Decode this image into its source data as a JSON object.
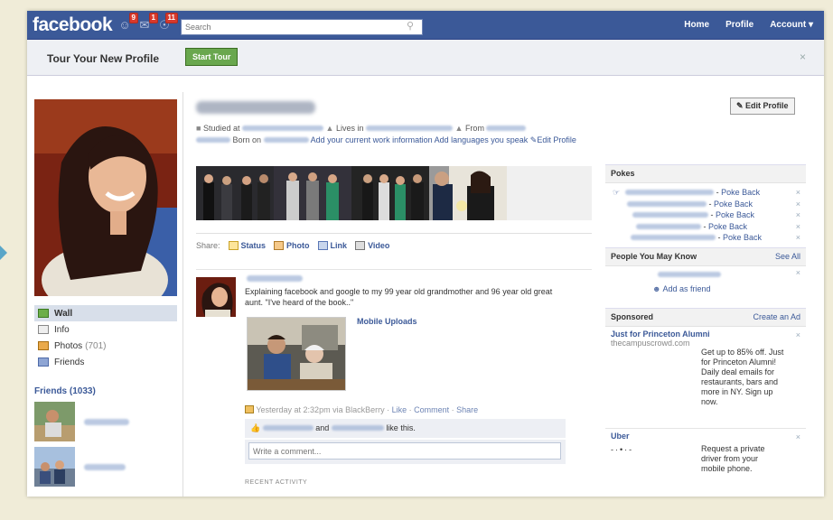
{
  "topbar": {
    "logo": "facebook",
    "jewels": [
      {
        "icon": "friend-requests-icon",
        "count": "9"
      },
      {
        "icon": "messages-icon",
        "count": "1"
      },
      {
        "icon": "notifications-icon",
        "count": "11"
      }
    ],
    "search_placeholder": "Search",
    "nav": [
      "Home",
      "Profile",
      "Account ▾"
    ]
  },
  "tour": {
    "text": "Tour Your New Profile",
    "button": "Start Tour",
    "close": "×"
  },
  "profile": {
    "edit_profile_button": "✎ Edit Profile",
    "info_studied": "Studied at",
    "info_lives": "Lives in",
    "info_from": "From",
    "info_born": "Born on",
    "add_work": "Add your current work information",
    "add_languages": "Add languages you speak",
    "edit_profile_link": "Edit Profile"
  },
  "left_nav": {
    "items": [
      {
        "label": "Wall",
        "selected": true,
        "icon": "wall-icon"
      },
      {
        "label": "Info",
        "selected": false,
        "icon": "info-icon"
      },
      {
        "label": "Photos",
        "count": "(701)",
        "selected": false,
        "icon": "photos-icon"
      },
      {
        "label": "Friends",
        "selected": false,
        "icon": "friends-icon"
      }
    ],
    "friends_heading": "Friends (1033)"
  },
  "share": {
    "label": "Share:",
    "options": [
      "Status",
      "Photo",
      "Link",
      "Video"
    ]
  },
  "post": {
    "text": "Explaining facebook and google to my 99 year old grandmother and 96 year old great aunt. \"I've heard of the book..\"",
    "album": "Mobile Uploads",
    "meta_time": "Yesterday at 2:32pm via BlackBerry",
    "actions": [
      "Like",
      "Comment",
      "Share"
    ],
    "likes_joiner": "and",
    "likes_suffix": "like this.",
    "comment_placeholder": "Write a comment...",
    "recent_activity": "RECENT ACTIVITY"
  },
  "sidebar": {
    "pokes_heading": "Pokes",
    "poke_back": "Poke Back",
    "pymk_heading": "People You May Know",
    "see_all": "See All",
    "add_friend": "Add as friend",
    "sponsored_heading": "Sponsored",
    "create_ad": "Create an Ad",
    "ads": [
      {
        "title": "Just for Princeton Alumni",
        "url": "thecampuscrowd.com",
        "body": "Get up to 85% off. Just for Princeton Alumni! Daily deal emails for restaurants, bars and more in NY. Sign up now."
      },
      {
        "title": "Uber",
        "url": "",
        "body": "Request a private driver from your mobile phone."
      }
    ]
  }
}
